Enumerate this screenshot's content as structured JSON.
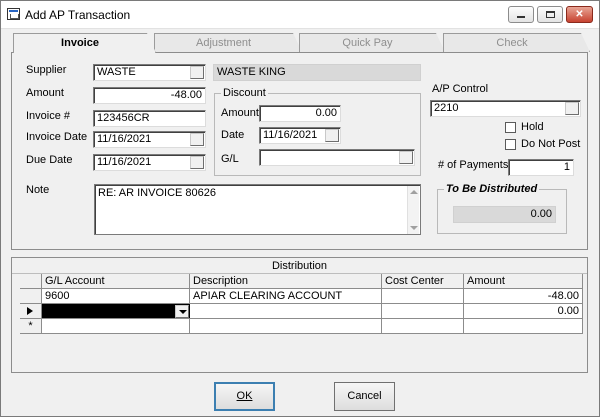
{
  "window": {
    "title": "Add AP Transaction",
    "icon": "app-form-icon"
  },
  "window_controls": {
    "minimize": "minimize-icon",
    "maximize": "maximize-icon",
    "close": "✕"
  },
  "tabs": [
    {
      "label": "Invoice",
      "active": true
    },
    {
      "label": "Adjustment",
      "active": false
    },
    {
      "label": "Quick Pay",
      "active": false
    },
    {
      "label": "Check",
      "active": false
    }
  ],
  "invoice": {
    "supplier_label": "Supplier",
    "supplier_code": "WASTE",
    "supplier_name": "WASTE KING",
    "amount_label": "Amount",
    "amount": "-48.00",
    "invoice_no_label": "Invoice #",
    "invoice_no": "123456CR",
    "invoice_date_label": "Invoice Date",
    "invoice_date": "11/16/2021",
    "due_date_label": "Due Date",
    "due_date": "11/16/2021",
    "note_label": "Note",
    "note": "RE: AR INVOICE 80626"
  },
  "discount": {
    "legend": "Discount",
    "amount_label": "Amount",
    "amount": "0.00",
    "date_label": "Date",
    "date": "11/16/2021",
    "gl_label": "G/L",
    "gl": ""
  },
  "ap": {
    "control_label": "A/P Control",
    "control": "2210",
    "hold_label": "Hold",
    "hold_checked": false,
    "do_not_post_label": "Do Not Post",
    "do_not_post_checked": false,
    "payments_label": "# of Payments",
    "payments": "1",
    "to_be_distributed_legend": "To Be Distributed",
    "to_be_distributed": "0.00"
  },
  "distribution": {
    "title": "Distribution",
    "columns": [
      "G/L Account",
      "Description",
      "Cost Center",
      "Amount"
    ],
    "rows": [
      {
        "marker": "",
        "gl_account": "9600",
        "description": "APIAR CLEARING ACCOUNT",
        "cost_center": "",
        "amount": "-48.00"
      },
      {
        "marker": "current",
        "gl_account": "",
        "description": "",
        "cost_center": "",
        "amount": "0.00"
      },
      {
        "marker": "*",
        "gl_account": "",
        "description": "",
        "cost_center": "",
        "amount": ""
      }
    ]
  },
  "buttons": {
    "ok": "OK",
    "cancel": "Cancel"
  }
}
